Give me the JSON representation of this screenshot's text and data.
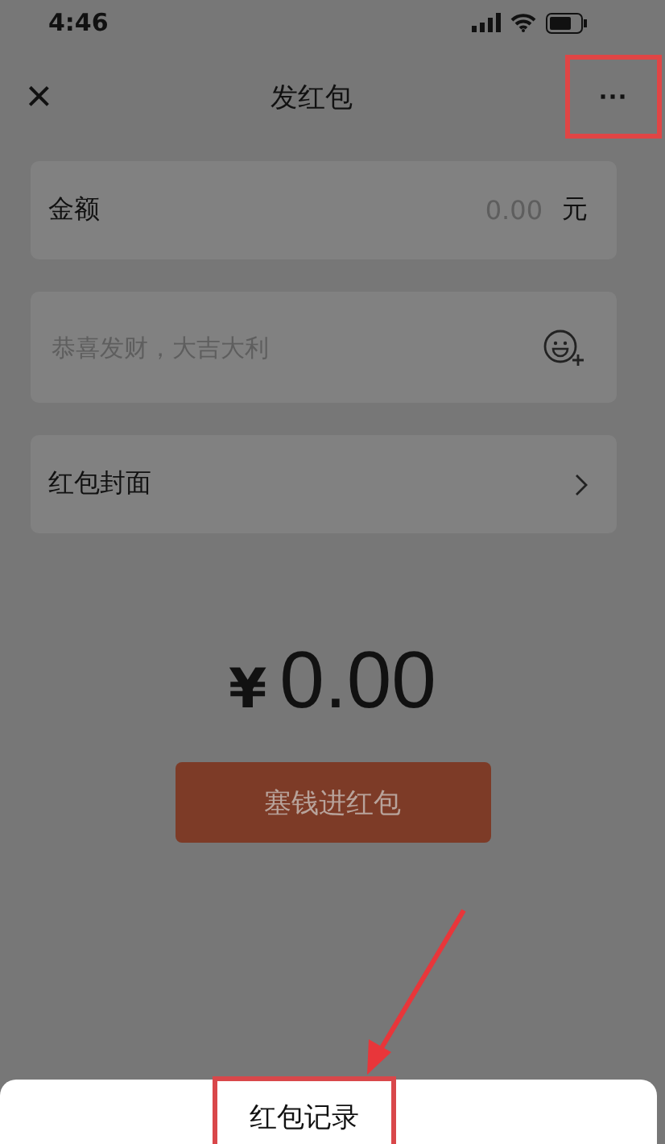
{
  "status_bar": {
    "time": "4:46"
  },
  "nav": {
    "close": "×",
    "title": "发红包",
    "more": "···",
    "more_highlighted": true
  },
  "form": [
    {
      "kind": "amount",
      "label": "金额",
      "placeholder": "0.00",
      "unit": "元"
    },
    {
      "kind": "message",
      "placeholder": "恭喜发财，大吉大利"
    },
    {
      "kind": "link",
      "label": "红包封面"
    }
  ],
  "total": {
    "currency": "¥",
    "amount": "0.00"
  },
  "submit_button": "塞钱进红包",
  "sheet": {
    "items": [
      {
        "label": "红包记录",
        "highlighted": true
      }
    ]
  }
}
